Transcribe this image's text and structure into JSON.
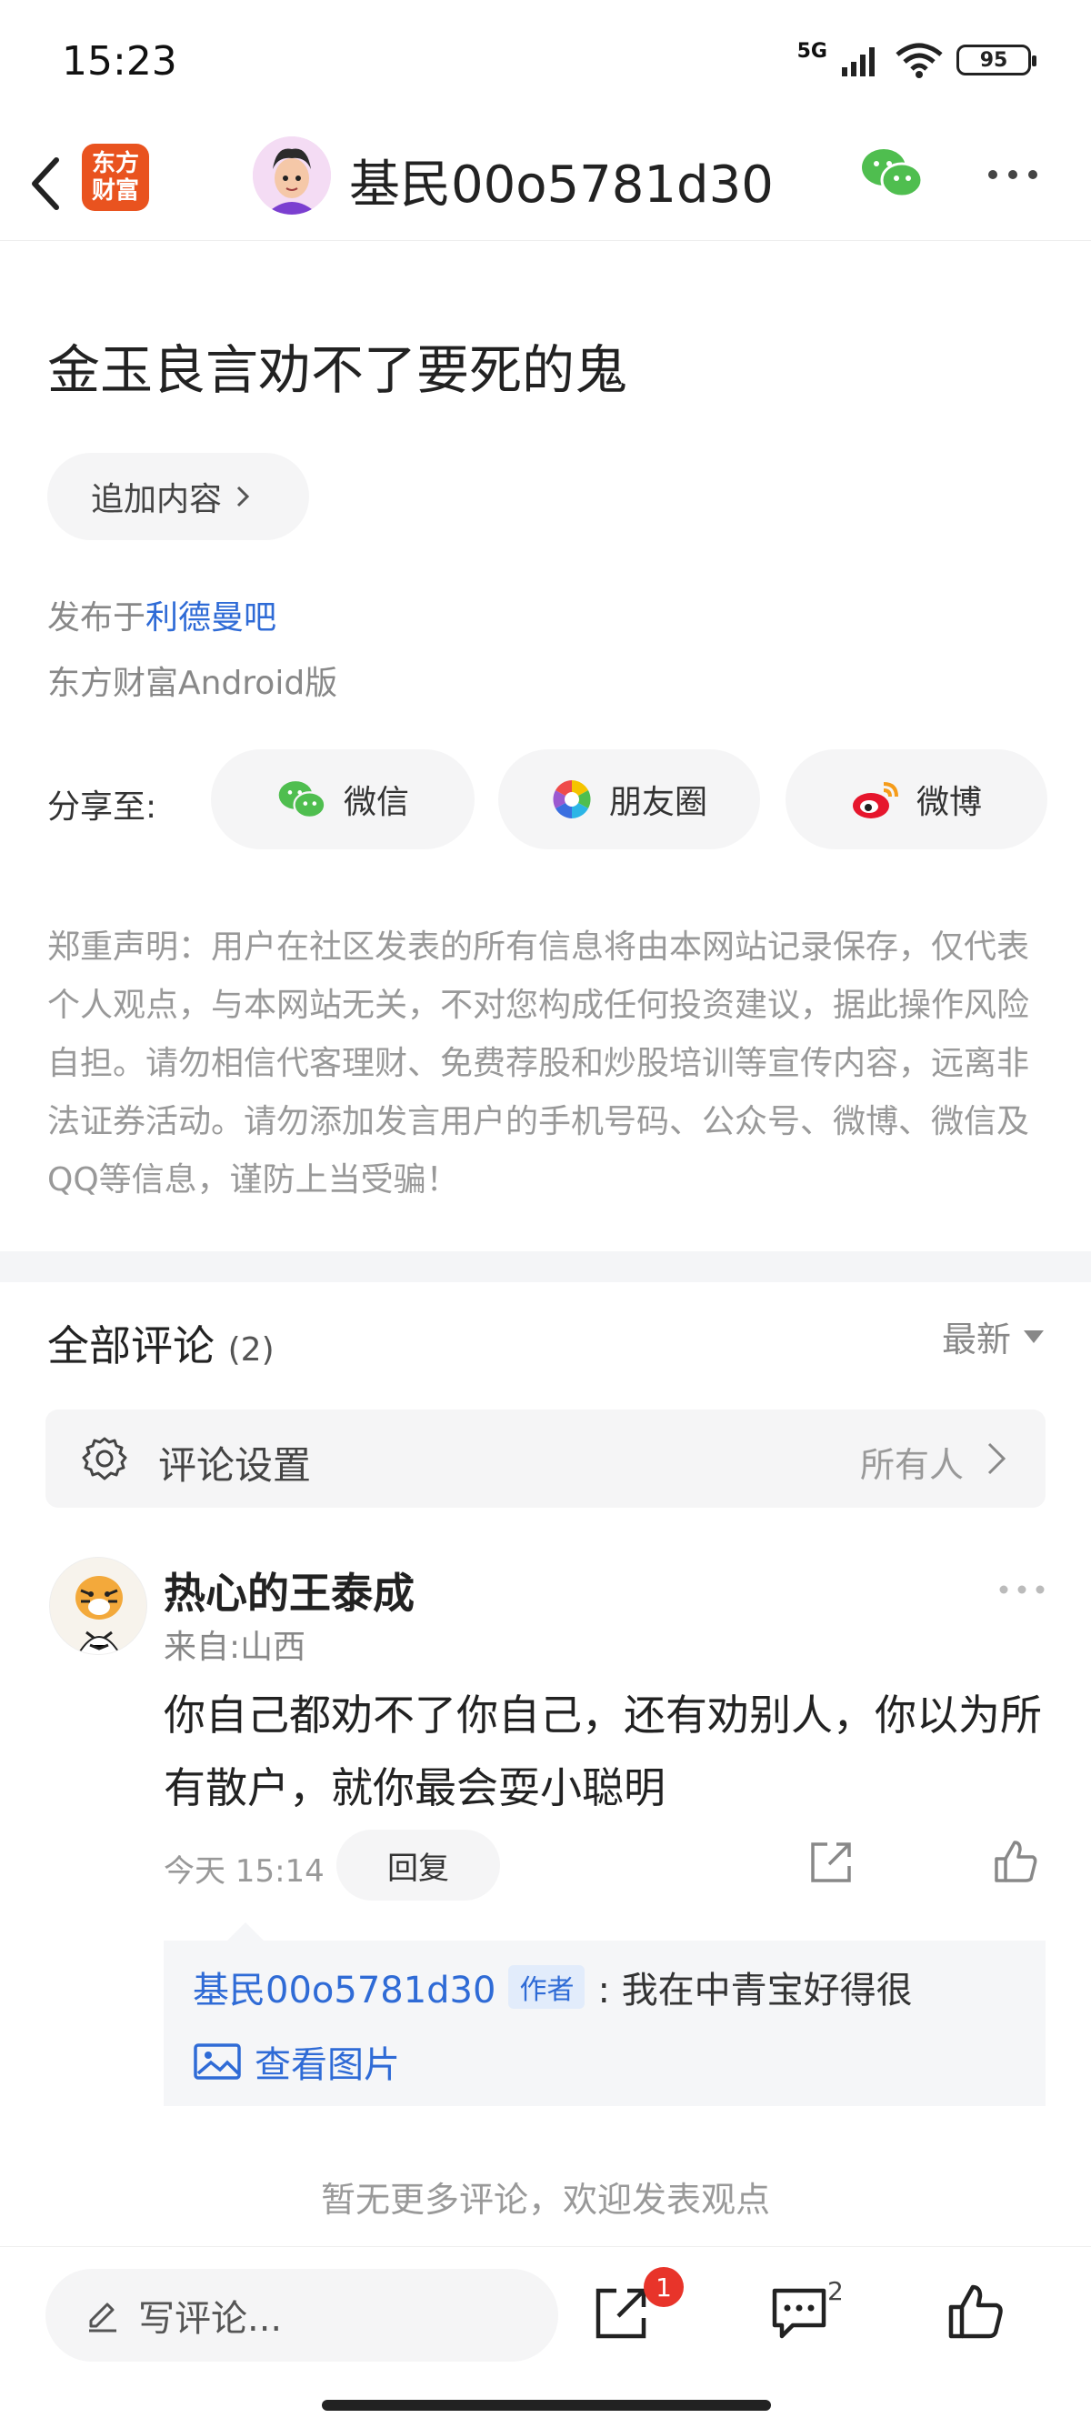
{
  "status_bar": {
    "time": "15:23",
    "network": "5G",
    "battery": "95"
  },
  "nav": {
    "app_logo_text": "东方财富",
    "title": "基民00o5781d30"
  },
  "post": {
    "title": "金玉良言劝不了要死的鬼",
    "append_label": "追加内容",
    "published_prefix": "发布于",
    "forum_name": "利德曼吧",
    "client": "东方财富Android版"
  },
  "share": {
    "label": "分享至:",
    "wechat": "微信",
    "moments": "朋友圈",
    "weibo": "微博"
  },
  "disclaimer": "郑重声明：用户在社区发表的所有信息将由本网站记录保存，仅代表个人观点，与本网站无关，不对您构成任何投资建议，据此操作风险自担。请勿相信代客理财、免费荐股和炒股培训等宣传内容，远离非法证券活动。请勿添加发言用户的手机号码、公众号、微博、微信及QQ等信息，谨防上当受骗！",
  "comments": {
    "title": "全部评论",
    "count": "(2)",
    "sort": "最新",
    "settings_label": "评论设置",
    "settings_value": "所有人",
    "items": [
      {
        "name": "热心的王泰成",
        "location": "来自:山西",
        "text": "你自己都劝不了你自己，还有劝别人，你以为所有散户，就你最会耍小聪明",
        "time": "今天 15:14",
        "reply_label": "回复",
        "reply": {
          "user": "基民00o5781d30",
          "tag": "作者",
          "text": ": 我在中青宝好得很",
          "view_image": "查看图片"
        }
      }
    ],
    "no_more": "暂无更多评论，欢迎发表观点"
  },
  "bottom_bar": {
    "write_placeholder": "写评论...",
    "share_badge": "1",
    "comment_count": "2"
  },
  "colors": {
    "accent": "#2f6bd6",
    "badge": "#e8342a",
    "logo": "#e9531f",
    "wechat": "#4fbe4f"
  }
}
